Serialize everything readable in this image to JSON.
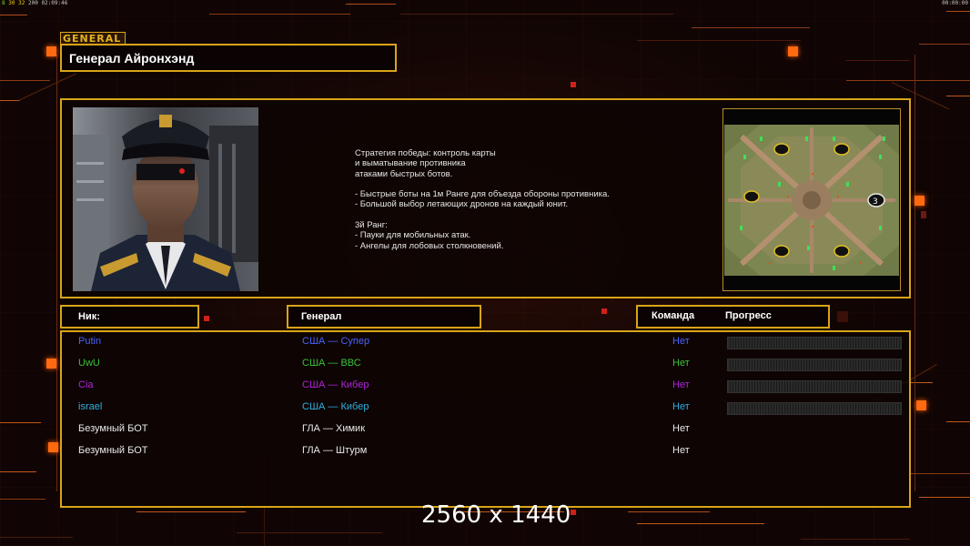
{
  "status_bar": {
    "left_fps": "8",
    "left_a": "30",
    "left_b": "32",
    "left_c": "200",
    "left_time": "02:09:46",
    "right_time": "00:00:00"
  },
  "general": {
    "tag": "GENERAL",
    "name": "Генерал Айронхэнд",
    "description_lines": [
      "Стратегия победы: контроль карты",
      "и выматывание противника",
      "атаками быстрых ботов.",
      "",
      "- Быстрые боты на 1м Ранге для объезда обороны противника.",
      "- Большой выбор летающих дронов на каждый юнит.",
      "",
      "3й Ранг:",
      "- Пауки для мобильных атак.",
      "- Ангелы для лобовых столкновений."
    ],
    "minimap_player_label": "3"
  },
  "table": {
    "headers": {
      "nick": "Ник:",
      "general": "Генерал",
      "team": "Команда",
      "progress": "Прогресс"
    },
    "rows": [
      {
        "nick": "Putin",
        "general": "США — Супер",
        "team": "Нет",
        "color": "#4a62ff",
        "show_progress": true
      },
      {
        "nick": "UwU",
        "general": "США — ВВС",
        "team": "Нет",
        "color": "#3cc13c",
        "show_progress": true
      },
      {
        "nick": "Cia",
        "general": "США — Кибер",
        "team": "Нет",
        "color": "#b025d8",
        "show_progress": true
      },
      {
        "nick": "israel",
        "general": "США — Кибер",
        "team": "Нет",
        "color": "#2fb0e0",
        "show_progress": true
      },
      {
        "nick": "Безумный БОТ",
        "general": "ГЛА — Химик",
        "team": "Нет",
        "color": "#e8e8e8",
        "show_progress": false
      },
      {
        "nick": "Безумный БОТ",
        "general": "ГЛА — Штурм",
        "team": "Нет",
        "color": "#e8e8e8",
        "show_progress": false
      }
    ]
  },
  "watermark": "2560 x 1440",
  "colors": {
    "frame": "#d9a418",
    "accent_orange": "#ff6a10",
    "background": "#100504"
  }
}
